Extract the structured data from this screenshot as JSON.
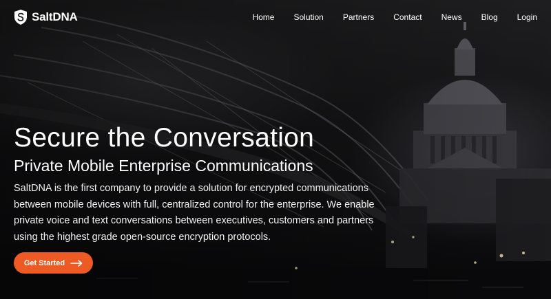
{
  "brand": {
    "name": "SaltDNA",
    "accent_color": "#ee5a24",
    "logo_icon": "shield-s-icon"
  },
  "nav": {
    "items": [
      {
        "label": "Home"
      },
      {
        "label": "Solution"
      },
      {
        "label": "Partners"
      },
      {
        "label": "Contact"
      },
      {
        "label": "News"
      },
      {
        "label": "Blog"
      },
      {
        "label": "Login"
      }
    ]
  },
  "hero": {
    "headline": "Secure the Conversation",
    "subheadline": "Private Mobile Enterprise Communications",
    "description": "SaltDNA is the first company to provide a solution for encrypted communications between mobile devices with full, centralized control for the enterprise. We enable private voice and text conversations between executives, customers and partners using the highest grade open-source encryption protocols.",
    "cta_label": "Get Started",
    "cta_icon": "arrow-right-icon"
  }
}
